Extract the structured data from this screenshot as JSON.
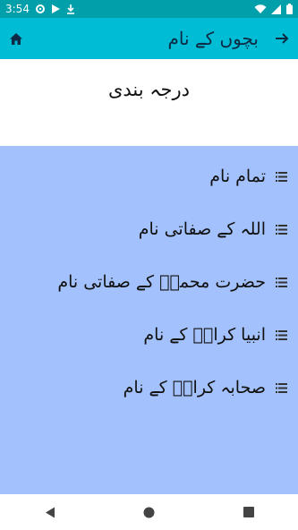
{
  "status_bar": {
    "time": "3:54"
  },
  "app_bar": {
    "title": "بچوں کے نام"
  },
  "header": {
    "title": "درجہ بندی"
  },
  "categories": [
    {
      "label": "تمام نام"
    },
    {
      "label": "اللہ کے صفاتی نام"
    },
    {
      "label": "حضرت محمدؐ کے صفاتی نام"
    },
    {
      "label": "انبیا کرامؑ کے نام"
    },
    {
      "label": "صحابہ کرامؓ کے نام"
    }
  ],
  "colors": {
    "status_bar": "#009faa",
    "app_bar": "#00bcd4",
    "list_background": "#a3c1fc"
  },
  "icons": {
    "status": [
      "gear-icon",
      "play-store-icon",
      "download-icon",
      "wifi-icon",
      "signal-icon",
      "battery-icon"
    ],
    "app_bar": [
      "home-icon",
      "arrow-forward-icon"
    ],
    "list_item": "menu-lines-icon",
    "nav": [
      "back-icon",
      "home-circle-icon",
      "recents-icon"
    ]
  }
}
